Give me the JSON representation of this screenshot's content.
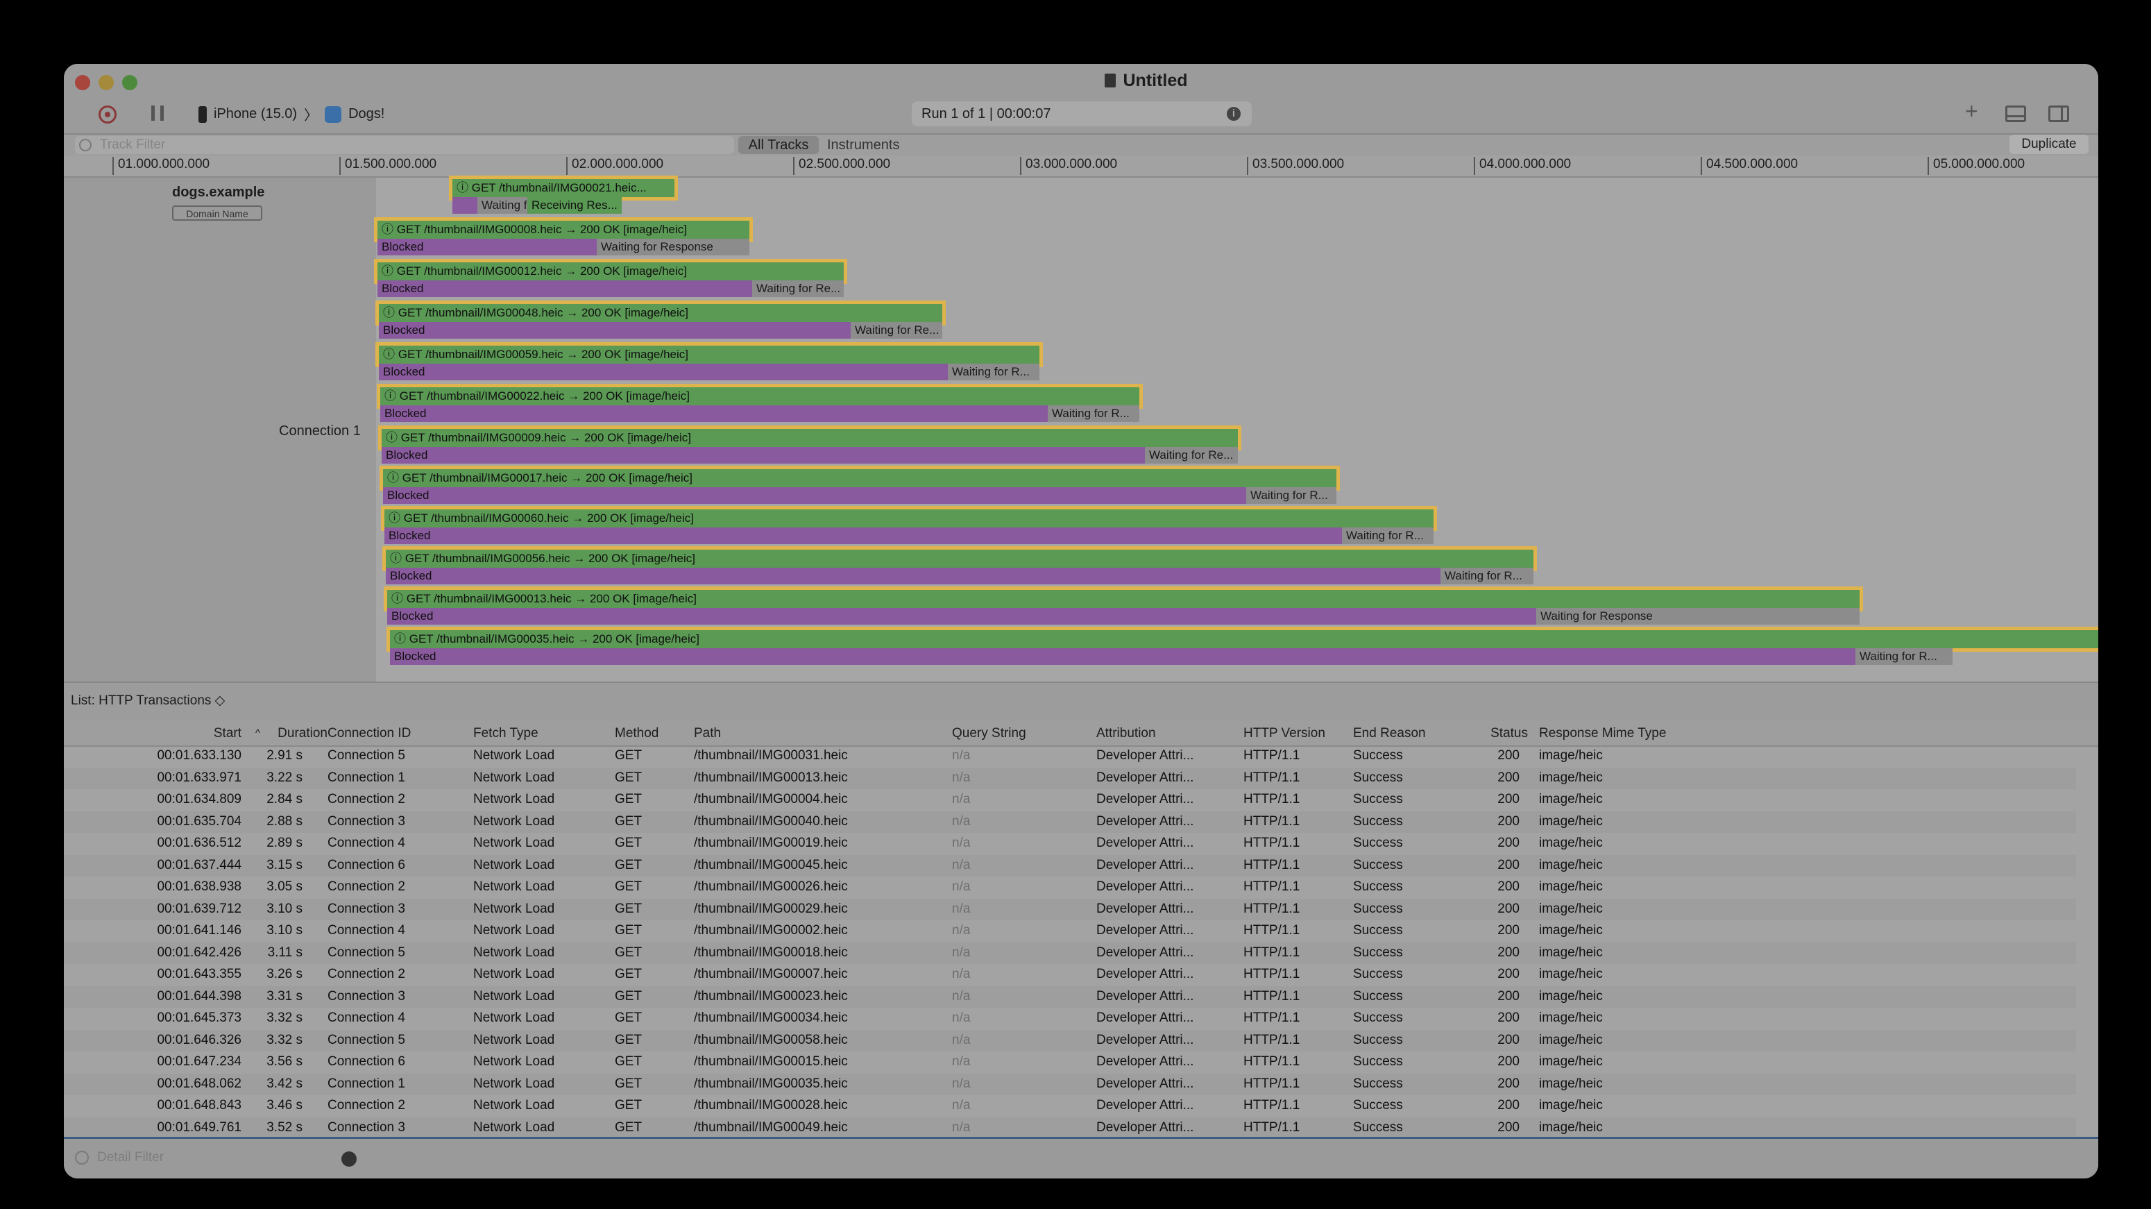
{
  "window": {
    "title": "Untitled"
  },
  "toolbar": {
    "device": "iPhone (15.0)",
    "separator": "〉",
    "app": "Dogs!",
    "run_status": "Run 1 of 1  |  00:00:07",
    "info_glyph": "i",
    "plus_glyph": "+"
  },
  "filterbar": {
    "track_filter_placeholder": "Track Filter",
    "all_tracks": "All Tracks",
    "instruments": "Instruments",
    "duplicate": "Duplicate"
  },
  "ruler": {
    "ticks": [
      "01.000.000.000",
      "01.500.000.000",
      "02.000.000.000",
      "02.500.000.000",
      "03.000.000.000",
      "03.500.000.000",
      "04.000.000.000",
      "04.500.000.000",
      "05.000.000.000"
    ]
  },
  "tracks": {
    "domain": "dogs.example",
    "domain_popup": "Domain Name",
    "connection": "Connection 1",
    "requests": [
      {
        "label": "ⓘ GET /thumbnail/IMG00021.heic...",
        "blocked": "",
        "wait": "Waiting for R...",
        "recv": "Receiving Res..."
      },
      {
        "label": "ⓘ GET /thumbnail/IMG00008.heic → 200 OK [image/heic]",
        "blocked": "Blocked",
        "wait": "Waiting for Response"
      },
      {
        "label": "ⓘ GET /thumbnail/IMG00012.heic → 200 OK [image/heic]",
        "blocked": "Blocked",
        "wait": "Waiting for Re..."
      },
      {
        "label": "ⓘ GET /thumbnail/IMG00048.heic → 200 OK [image/heic]",
        "blocked": "Blocked",
        "wait": "Waiting for Re..."
      },
      {
        "label": "ⓘ GET /thumbnail/IMG00059.heic → 200 OK [image/heic]",
        "blocked": "Blocked",
        "wait": "Waiting for R..."
      },
      {
        "label": "ⓘ GET /thumbnail/IMG00022.heic → 200 OK [image/heic]",
        "blocked": "Blocked",
        "wait": "Waiting for R..."
      },
      {
        "label": "ⓘ GET /thumbnail/IMG00009.heic → 200 OK [image/heic]",
        "blocked": "Blocked",
        "wait": "Waiting for Re..."
      },
      {
        "label": "ⓘ GET /thumbnail/IMG00017.heic → 200 OK [image/heic]",
        "blocked": "Blocked",
        "wait": "Waiting for R..."
      },
      {
        "label": "ⓘ GET /thumbnail/IMG00060.heic → 200 OK [image/heic]",
        "blocked": "Blocked",
        "wait": "Waiting for R..."
      },
      {
        "label": "ⓘ GET /thumbnail/IMG00056.heic → 200 OK [image/heic]",
        "blocked": "Blocked",
        "wait": "Waiting for R..."
      },
      {
        "label": "ⓘ GET /thumbnail/IMG00013.heic → 200 OK [image/heic]",
        "blocked": "Blocked",
        "wait": "Waiting for Response"
      },
      {
        "label": "ⓘ GET /thumbnail/IMG00035.heic → 200 OK [image/heic]",
        "blocked": "Blocked",
        "wait": "Waiting for R..."
      }
    ]
  },
  "detail": {
    "list_label": "List: HTTP Transactions ◇",
    "columns": [
      "Start",
      "Duration",
      "Connection ID",
      "Fetch Type",
      "Method",
      "Path",
      "Query String",
      "Attribution",
      "HTTP Version",
      "End Reason",
      "Status",
      "Response Mime Type"
    ],
    "sort_glyph": "^",
    "rows": [
      [
        "00:01.633.130",
        "2.91 s",
        "Connection 5",
        "Network Load",
        "GET",
        "/thumbnail/IMG00031.heic",
        "n/a",
        "Developer Attri...",
        "HTTP/1.1",
        "Success",
        "200",
        "image/heic"
      ],
      [
        "00:01.633.971",
        "3.22 s",
        "Connection 1",
        "Network Load",
        "GET",
        "/thumbnail/IMG00013.heic",
        "n/a",
        "Developer Attri...",
        "HTTP/1.1",
        "Success",
        "200",
        "image/heic"
      ],
      [
        "00:01.634.809",
        "2.84 s",
        "Connection 2",
        "Network Load",
        "GET",
        "/thumbnail/IMG00004.heic",
        "n/a",
        "Developer Attri...",
        "HTTP/1.1",
        "Success",
        "200",
        "image/heic"
      ],
      [
        "00:01.635.704",
        "2.88 s",
        "Connection 3",
        "Network Load",
        "GET",
        "/thumbnail/IMG00040.heic",
        "n/a",
        "Developer Attri...",
        "HTTP/1.1",
        "Success",
        "200",
        "image/heic"
      ],
      [
        "00:01.636.512",
        "2.89 s",
        "Connection 4",
        "Network Load",
        "GET",
        "/thumbnail/IMG00019.heic",
        "n/a",
        "Developer Attri...",
        "HTTP/1.1",
        "Success",
        "200",
        "image/heic"
      ],
      [
        "00:01.637.444",
        "3.15 s",
        "Connection 6",
        "Network Load",
        "GET",
        "/thumbnail/IMG00045.heic",
        "n/a",
        "Developer Attri...",
        "HTTP/1.1",
        "Success",
        "200",
        "image/heic"
      ],
      [
        "00:01.638.938",
        "3.05 s",
        "Connection 2",
        "Network Load",
        "GET",
        "/thumbnail/IMG00026.heic",
        "n/a",
        "Developer Attri...",
        "HTTP/1.1",
        "Success",
        "200",
        "image/heic"
      ],
      [
        "00:01.639.712",
        "3.10 s",
        "Connection 3",
        "Network Load",
        "GET",
        "/thumbnail/IMG00029.heic",
        "n/a",
        "Developer Attri...",
        "HTTP/1.1",
        "Success",
        "200",
        "image/heic"
      ],
      [
        "00:01.641.146",
        "3.10 s",
        "Connection 4",
        "Network Load",
        "GET",
        "/thumbnail/IMG00002.heic",
        "n/a",
        "Developer Attri...",
        "HTTP/1.1",
        "Success",
        "200",
        "image/heic"
      ],
      [
        "00:01.642.426",
        "3.11 s",
        "Connection 5",
        "Network Load",
        "GET",
        "/thumbnail/IMG00018.heic",
        "n/a",
        "Developer Attri...",
        "HTTP/1.1",
        "Success",
        "200",
        "image/heic"
      ],
      [
        "00:01.643.355",
        "3.26 s",
        "Connection 2",
        "Network Load",
        "GET",
        "/thumbnail/IMG00007.heic",
        "n/a",
        "Developer Attri...",
        "HTTP/1.1",
        "Success",
        "200",
        "image/heic"
      ],
      [
        "00:01.644.398",
        "3.31 s",
        "Connection 3",
        "Network Load",
        "GET",
        "/thumbnail/IMG00023.heic",
        "n/a",
        "Developer Attri...",
        "HTTP/1.1",
        "Success",
        "200",
        "image/heic"
      ],
      [
        "00:01.645.373",
        "3.32 s",
        "Connection 4",
        "Network Load",
        "GET",
        "/thumbnail/IMG00034.heic",
        "n/a",
        "Developer Attri...",
        "HTTP/1.1",
        "Success",
        "200",
        "image/heic"
      ],
      [
        "00:01.646.326",
        "3.32 s",
        "Connection 5",
        "Network Load",
        "GET",
        "/thumbnail/IMG00058.heic",
        "n/a",
        "Developer Attri...",
        "HTTP/1.1",
        "Success",
        "200",
        "image/heic"
      ],
      [
        "00:01.647.234",
        "3.56 s",
        "Connection 6",
        "Network Load",
        "GET",
        "/thumbnail/IMG00015.heic",
        "n/a",
        "Developer Attri...",
        "HTTP/1.1",
        "Success",
        "200",
        "image/heic"
      ],
      [
        "00:01.648.062",
        "3.42 s",
        "Connection 1",
        "Network Load",
        "GET",
        "/thumbnail/IMG00035.heic",
        "n/a",
        "Developer Attri...",
        "HTTP/1.1",
        "Success",
        "200",
        "image/heic"
      ],
      [
        "00:01.648.843",
        "3.46 s",
        "Connection 2",
        "Network Load",
        "GET",
        "/thumbnail/IMG00028.heic",
        "n/a",
        "Developer Attri...",
        "HTTP/1.1",
        "Success",
        "200",
        "image/heic"
      ],
      [
        "00:01.649.761",
        "3.52 s",
        "Connection 3",
        "Network Load",
        "GET",
        "/thumbnail/IMG00049.heic",
        "n/a",
        "Developer Attri...",
        "HTTP/1.1",
        "Success",
        "200",
        "image/heic"
      ]
    ]
  },
  "bottombar": {
    "detail_filter_placeholder": "Detail Filter"
  },
  "colors": {
    "request": "#5a9a54",
    "blocked": "#8a5a9e",
    "waiting": "#8c8c8c",
    "highlight": "#e0b44c"
  }
}
